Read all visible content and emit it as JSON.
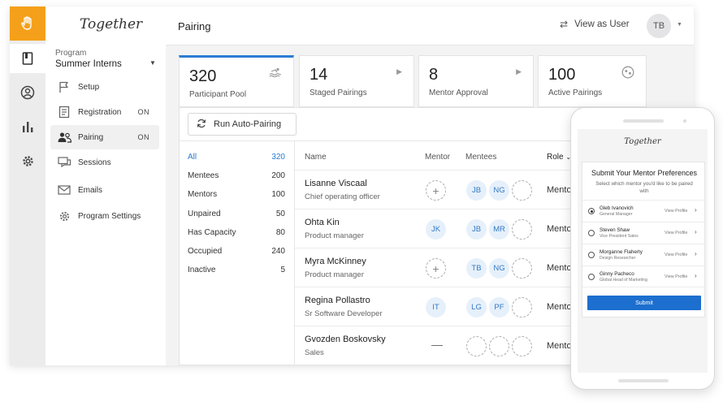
{
  "app": {
    "brand": "Together",
    "colors": {
      "accent": "#2b7cd3",
      "logo_bg": "#f5a01a",
      "chip_bg": "#e6f0fa",
      "submit": "#1c6fce"
    }
  },
  "rail": {
    "icons": [
      "hand-logo-icon",
      "book-icon",
      "user-circle-icon",
      "bar-chart-icon",
      "gear-icon"
    ]
  },
  "sidebar": {
    "program_label": "Program",
    "program_value": "Summer Interns",
    "items": [
      {
        "label": "Setup",
        "icon": "flag-icon",
        "badge": ""
      },
      {
        "label": "Registration",
        "icon": "form-icon",
        "badge": "ON"
      },
      {
        "label": "Pairing",
        "icon": "people-icon",
        "badge": "ON"
      },
      {
        "label": "Sessions",
        "icon": "chat-icon",
        "badge": ""
      },
      {
        "label": "Emails",
        "icon": "mail-icon",
        "badge": ""
      },
      {
        "label": "Program Settings",
        "icon": "gear-icon",
        "badge": ""
      }
    ]
  },
  "header": {
    "title": "Pairing",
    "view_as": "View as User",
    "avatar": "TB"
  },
  "stats": [
    {
      "num": "320",
      "label": "Participant Pool",
      "icon": "pool-icon"
    },
    {
      "num": "14",
      "label": "Staged Pairings",
      "icon": "play-icon"
    },
    {
      "num": "8",
      "label": "Mentor Approval",
      "icon": "play-icon"
    },
    {
      "num": "100",
      "label": "Active Pairings",
      "icon": "faces-icon"
    }
  ],
  "actions": {
    "auto_pairing": "Run Auto-Pairing"
  },
  "filters": [
    {
      "label": "All",
      "count": "320"
    },
    {
      "label": "Mentees",
      "count": "200"
    },
    {
      "label": "Mentors",
      "count": "100"
    },
    {
      "label": "Unpaired",
      "count": "50"
    },
    {
      "label": "Has Capacity",
      "count": "80"
    },
    {
      "label": "Occupied",
      "count": "240"
    },
    {
      "label": "Inactive",
      "count": "5"
    }
  ],
  "table": {
    "columns": {
      "name": "Name",
      "mentor": "Mentor",
      "mentees": "Mentees",
      "role": "Role"
    },
    "rows": [
      {
        "name": "Lisanne Viscaal",
        "title": "Chief operating officer",
        "mentor": "",
        "mentees": [
          "JB",
          "NG"
        ],
        "role": "Mento"
      },
      {
        "name": "Ohta Kin",
        "title": "Product manager",
        "mentor": "JK",
        "mentees": [
          "JB",
          "MR"
        ],
        "role": "Mento"
      },
      {
        "name": "Myra McKinney",
        "title": "Product manager",
        "mentor": "",
        "mentees": [
          "TB",
          "NG"
        ],
        "role": "Mento"
      },
      {
        "name": "Regina Pollastro",
        "title": "Sr Software Developer",
        "mentor": "IT",
        "mentees": [
          "LG",
          "PF"
        ],
        "role": "Mento"
      },
      {
        "name": "Gvozden Boskovsky",
        "title": "Sales",
        "mentor": "—",
        "mentees": [],
        "role": "Mento"
      }
    ]
  },
  "phone": {
    "brand": "Together",
    "title": "Submit Your Mentor Preferences",
    "subtitle": "Select which mentor you'd like to be paired with",
    "options": [
      {
        "name": "Gleb Ivanovich",
        "title": "General Manager",
        "link": "View Profile",
        "selected": true
      },
      {
        "name": "Steven Shaw",
        "title": "Vice President Sales",
        "link": "View Profile",
        "selected": false
      },
      {
        "name": "Morganne Flaherty",
        "title": "Design Researcher",
        "link": "View Profile",
        "selected": false
      },
      {
        "name": "Ginny Pacheco",
        "title": "Global Head of Marketing",
        "link": "View Profile",
        "selected": false
      }
    ],
    "submit": "Submit"
  }
}
